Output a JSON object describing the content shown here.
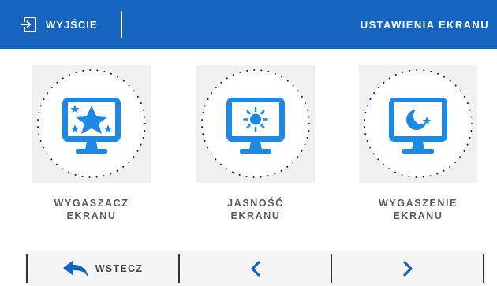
{
  "header": {
    "exit_label": "WYJŚCIE",
    "exit_icon": "exit-icon",
    "title": "USTAWIENIA EKRANU"
  },
  "tiles": [
    {
      "icon": "screensaver-monitor-icon",
      "label_line1": "WYGASZACZ",
      "label_line2": "EKRANU"
    },
    {
      "icon": "brightness-monitor-icon",
      "label_line1": "JASNOŚĆ",
      "label_line2": "EKRANU"
    },
    {
      "icon": "screen-off-monitor-icon",
      "label_line1": "WYGASZENIE",
      "label_line2": "EKRANU"
    }
  ],
  "footer": {
    "back_label": "WSTECZ",
    "back_icon": "back-arrow-icon",
    "prev_icon": "chevron-left-icon",
    "next_icon": "chevron-right-icon"
  },
  "colors": {
    "header_bg": "#1565c0",
    "accent_blue": "#1e88e5",
    "tile_bg": "#f0f0f0",
    "label_text": "#5b5b5b"
  }
}
